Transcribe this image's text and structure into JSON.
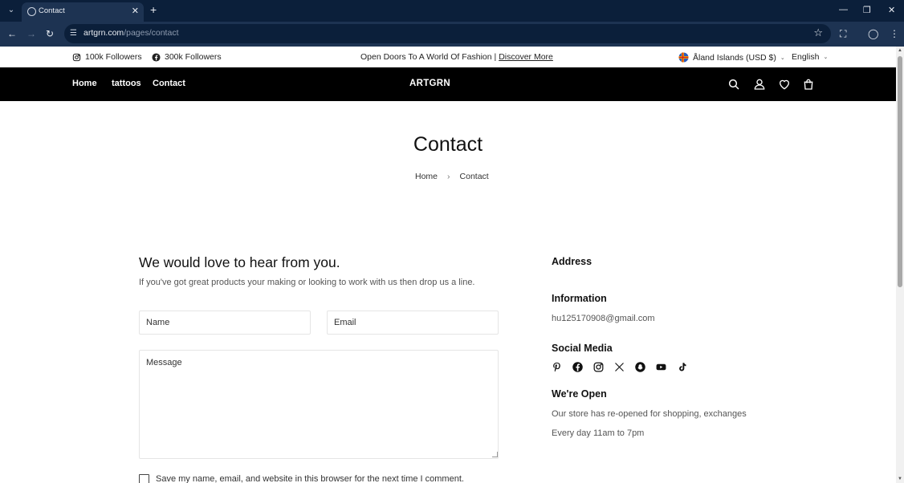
{
  "browser": {
    "tab_title": "Contact",
    "url_domain": "artgrn.com",
    "url_path": "/pages/contact"
  },
  "announcement": {
    "instagram_followers": "100k Followers",
    "facebook_followers": "300k Followers",
    "promo_text": "Open Doors To A World Of Fashion |",
    "promo_link": "Discover More",
    "currency": "Åland Islands (USD $)",
    "language": "English"
  },
  "header": {
    "nav": [
      "Home",
      "tattoos",
      "Contact"
    ],
    "logo": "ARTGRN"
  },
  "page": {
    "title": "Contact",
    "breadcrumb": [
      "Home",
      "Contact"
    ]
  },
  "form": {
    "heading": "We would love to hear from you.",
    "subheading": "If you've got great products your making or looking to work with us then drop us a line.",
    "name_placeholder": "Name",
    "email_placeholder": "Email",
    "message_placeholder": "Message",
    "save_info_label": "Save my name, email, and website in this browser for the next time I comment."
  },
  "sidebar": {
    "address_heading": "Address",
    "information_heading": "Information",
    "email": "hu125170908@gmail.com",
    "social_heading": "Social Media",
    "social_icons": [
      "pinterest-icon",
      "facebook-icon",
      "instagram-icon",
      "x-icon",
      "snapchat-icon",
      "youtube-icon",
      "tiktok-icon"
    ],
    "open_heading": "We're Open",
    "open_line1": "Our store has re-opened for shopping, exchanges",
    "open_line2": "Every day 11am to 7pm"
  }
}
